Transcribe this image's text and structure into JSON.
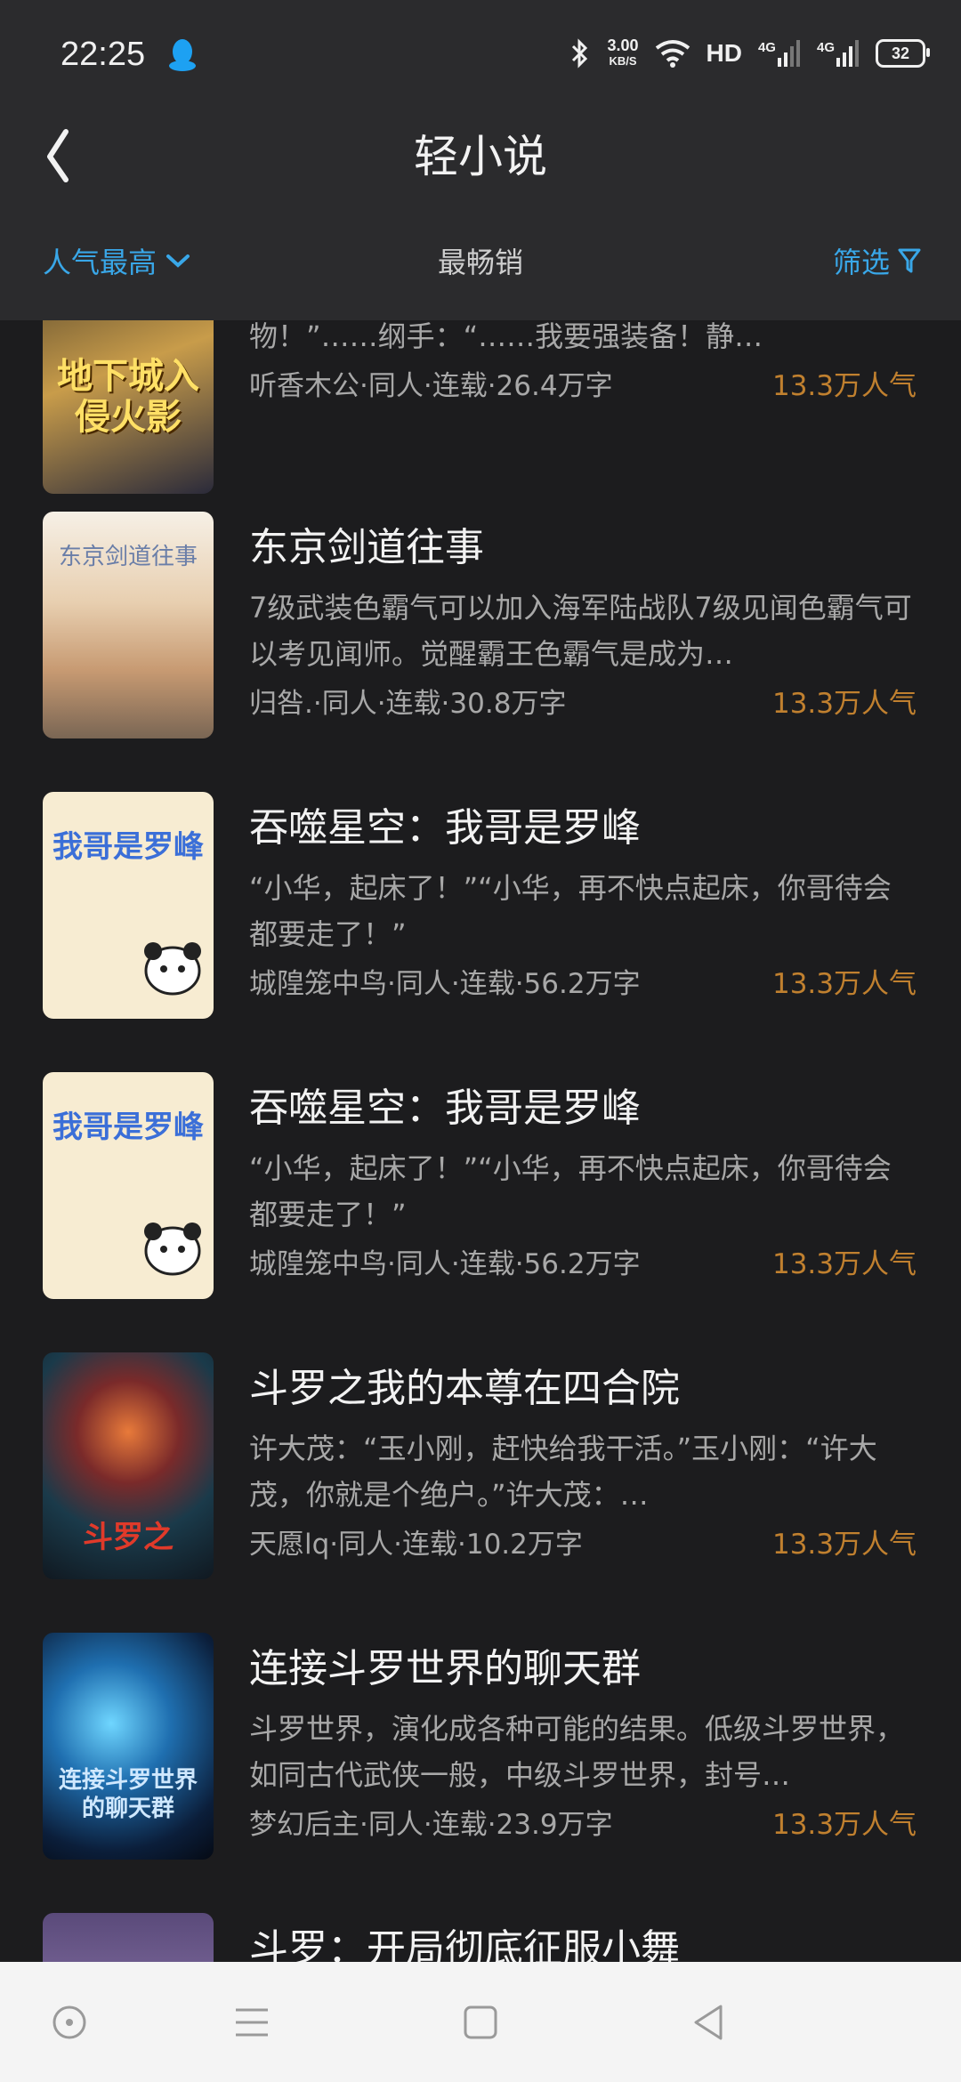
{
  "status": {
    "time": "22:25",
    "speed_value": "3.00",
    "speed_unit": "KB/S",
    "hd_label": "HD",
    "net1": "4G",
    "net2": "4G",
    "battery": "32"
  },
  "header": {
    "title": "轻小说",
    "sort_label": "人气最高",
    "bestseller_label": "最畅销",
    "filter_label": "筛选"
  },
  "books": [
    {
      "title": "",
      "desc": "宇智波斑：“……悲鸣深渊，来两有票的，不要废物！”……纲手：“……我要强装备！静…",
      "meta": "听香木公·同人·连载·26.4万字",
      "popularity": "13.3万人气",
      "cover_text": "地下城入侵火影"
    },
    {
      "title": "东京剑道往事",
      "desc": "7级武装色霸气可以加入海军陆战队7级见闻色霸气可以考见闻师。觉醒霸王色霸气是成为…",
      "meta": "归咎.·同人·连载·30.8万字",
      "popularity": "13.3万人气",
      "cover_text": "东京剑道往事"
    },
    {
      "title": "吞噬星空：我哥是罗峰",
      "desc": "“小华，起床了！”“小华，再不快点起床，你哥待会都要走了！”",
      "meta": "城隍笼中鸟·同人·连载·56.2万字",
      "popularity": "13.3万人气",
      "cover_text": "我哥是罗峰"
    },
    {
      "title": "吞噬星空：我哥是罗峰",
      "desc": "“小华，起床了！”“小华，再不快点起床，你哥待会都要走了！”",
      "meta": "城隍笼中鸟·同人·连载·56.2万字",
      "popularity": "13.3万人气",
      "cover_text": "我哥是罗峰"
    },
    {
      "title": "斗罗之我的本尊在四合院",
      "desc": "许大茂：“玉小刚，赶快给我干活。”玉小刚：“许大茂，你就是个绝户。”许大茂：…",
      "meta": "天愿lq·同人·连载·10.2万字",
      "popularity": "13.3万人气",
      "cover_text": "斗罗之"
    },
    {
      "title": "连接斗罗世界的聊天群",
      "desc": "斗罗世界，演化成各种可能的结果。低级斗罗世界，如同古代武侠一般，中级斗罗世界，封号…",
      "meta": "梦幻后主·同人·连载·23.9万字",
      "popularity": "13.3万人气",
      "cover_text": "连接斗罗世界的聊天群"
    },
    {
      "title": "斗罗：开局彻底征服小舞",
      "desc": "",
      "meta": "",
      "popularity": "",
      "cover_text": ""
    }
  ],
  "colors": {
    "accent": "#39a7e8",
    "popularity": "#c0802f",
    "background": "#1c1c1e",
    "header_bg": "#2b2b2d"
  },
  "icons": [
    "qq-icon",
    "bluetooth-icon",
    "wifi-icon",
    "signal-icon",
    "back-icon",
    "chevron-down-icon",
    "filter-icon",
    "home-icon",
    "menu-icon",
    "square-icon",
    "back-triangle-icon"
  ]
}
